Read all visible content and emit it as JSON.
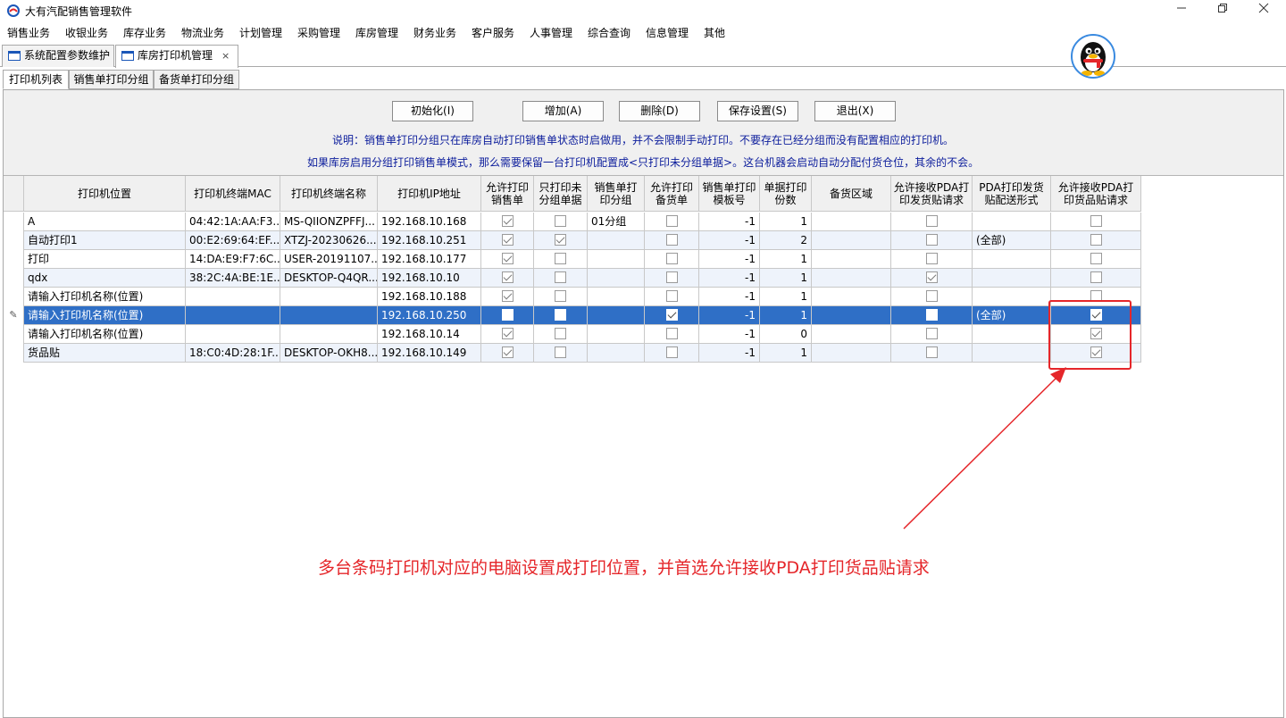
{
  "window": {
    "title": "大有汽配销售管理软件",
    "minimize_icon": "minimize-icon",
    "restore_icon": "restore-icon",
    "close_icon": "close-icon"
  },
  "menu": [
    "销售业务",
    "收银业务",
    "库存业务",
    "物流业务",
    "计划管理",
    "采购管理",
    "库房管理",
    "财务业务",
    "客户服务",
    "人事管理",
    "综合查询",
    "信息管理",
    "其他"
  ],
  "doc_tabs": [
    {
      "label": "系统配置参数维护"
    },
    {
      "label": "库房打印机管理",
      "close": "×"
    }
  ],
  "sub_tabs": [
    "打印机列表",
    "销售单打印分组",
    "备货单打印分组"
  ],
  "toolbar": {
    "init": "初始化(I)",
    "add": "增加(A)",
    "delete": "删除(D)",
    "save": "保存设置(S)",
    "exit": "退出(X)"
  },
  "notes": {
    "line1": "说明：销售单打印分组只在库房自动打印销售单状态时启做用，并不会限制手动打印。不要存在已经分组而没有配置相应的打印机。",
    "line2": "如果库房启用分组打印销售单模式，那么需要保留一台打印机配置成<只打印未分组单据>。这台机器会启动自动分配付货仓位，其余的不会。"
  },
  "columns": [
    "打印机位置",
    "打印机终端MAC",
    "打印机终端名称",
    "打印机IP地址",
    "允许打印销售单",
    "只打印未分组单据",
    "销售单打印分组",
    "允许打印备货单",
    "销售单打印模板号",
    "单据打印份数",
    "备货区域",
    "允许接收PDA打印发货贴请求",
    "PDA打印发货贴配送形式",
    "允许接收PDA打印货品贴请求"
  ],
  "rows": [
    {
      "location": "A",
      "mac": "04:42:1A:AA:F3...",
      "name": "MS-QIIONZPFFJ...",
      "ip": "192.168.10.168",
      "allow_sale": true,
      "only_ungrouped": false,
      "group": "01分组",
      "allow_stock": false,
      "template": "-1",
      "copies": "1",
      "area": "",
      "pda_ship": false,
      "pda_mode": "",
      "pda_goods": false
    },
    {
      "location": "自动打印1",
      "mac": "00:E2:69:64:EF...",
      "name": "XTZJ-20230626...",
      "ip": "192.168.10.251",
      "allow_sale": true,
      "only_ungrouped": true,
      "group": "",
      "allow_stock": false,
      "template": "-1",
      "copies": "2",
      "area": "",
      "pda_ship": false,
      "pda_mode": "(全部)",
      "pda_goods": false
    },
    {
      "location": "打印",
      "mac": "14:DA:E9:F7:6C...",
      "name": "USER-20191107...",
      "ip": "192.168.10.177",
      "allow_sale": true,
      "only_ungrouped": false,
      "group": "",
      "allow_stock": false,
      "template": "-1",
      "copies": "1",
      "area": "",
      "pda_ship": false,
      "pda_mode": "",
      "pda_goods": false
    },
    {
      "location": "qdx",
      "mac": "38:2C:4A:BE:1E...",
      "name": "DESKTOP-Q4QR...",
      "ip": "192.168.10.10",
      "allow_sale": true,
      "only_ungrouped": false,
      "group": "",
      "allow_stock": false,
      "template": "-1",
      "copies": "1",
      "area": "",
      "pda_ship": true,
      "pda_mode": "",
      "pda_goods": false
    },
    {
      "location": "请输入打印机名称(位置)",
      "mac": "",
      "name": "",
      "ip": "192.168.10.188",
      "allow_sale": true,
      "only_ungrouped": false,
      "group": "",
      "allow_stock": false,
      "template": "-1",
      "copies": "1",
      "area": "",
      "pda_ship": false,
      "pda_mode": "",
      "pda_goods": false
    },
    {
      "location": "请输入打印机名称(位置)",
      "mac": "",
      "name": "",
      "ip": "192.168.10.250",
      "allow_sale": false,
      "only_ungrouped": false,
      "group": "",
      "allow_stock": true,
      "template": "-1",
      "copies": "1",
      "area": "",
      "pda_ship": false,
      "pda_mode": "(全部)",
      "pda_goods": true,
      "selected": true
    },
    {
      "location": "请输入打印机名称(位置)",
      "mac": "",
      "name": "",
      "ip": "192.168.10.14",
      "allow_sale": true,
      "only_ungrouped": false,
      "group": "",
      "allow_stock": false,
      "template": "-1",
      "copies": "0",
      "area": "",
      "pda_ship": false,
      "pda_mode": "",
      "pda_goods": true
    },
    {
      "location": "货品贴",
      "mac": "18:C0:4D:28:1F...",
      "name": "DESKTOP-OKH8...",
      "ip": "192.168.10.149",
      "allow_sale": true,
      "only_ungrouped": false,
      "group": "",
      "allow_stock": false,
      "template": "-1",
      "copies": "1",
      "area": "",
      "pda_ship": false,
      "pda_mode": "",
      "pda_goods": true
    }
  ],
  "row_indicator": "✎",
  "annotation": "多台条码打印机对应的电脑设置成打印位置，并首选允许接收PDA打印货品贴请求",
  "colors": {
    "selection": "#2f6fc6",
    "annotation": "#e5262a",
    "note": "#0c1d9c"
  }
}
